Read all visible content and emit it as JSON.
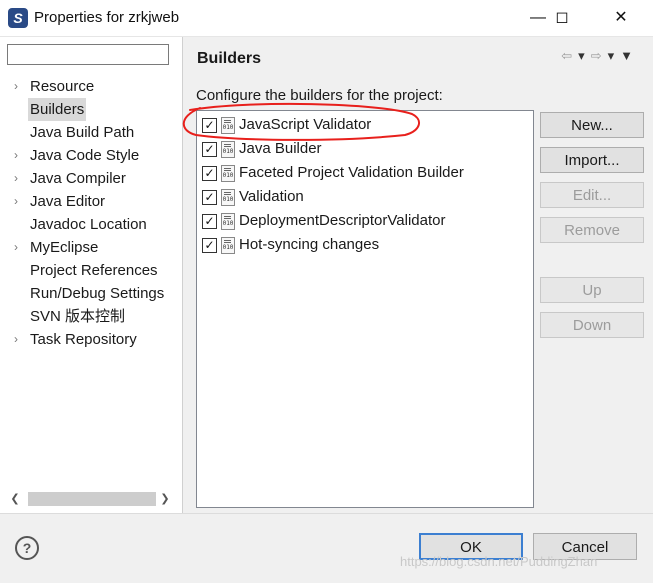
{
  "window": {
    "title": "Properties for zrkjweb",
    "app_icon": "myeclipse-icon"
  },
  "window_controls": [
    "minimize-icon",
    "maximize-icon",
    "close-icon"
  ],
  "left": {
    "filter_value": "",
    "items": [
      {
        "label": "Resource",
        "expandable": true
      },
      {
        "label": "Builders",
        "expandable": false,
        "selected": true
      },
      {
        "label": "Java Build Path",
        "expandable": false
      },
      {
        "label": "Java Code Style",
        "expandable": true
      },
      {
        "label": "Java Compiler",
        "expandable": true
      },
      {
        "label": "Java Editor",
        "expandable": true
      },
      {
        "label": "Javadoc Location",
        "expandable": false
      },
      {
        "label": "MyEclipse",
        "expandable": true
      },
      {
        "label": "Project References",
        "expandable": false
      },
      {
        "label": "Run/Debug Settings",
        "expandable": false
      },
      {
        "label": "SVN 版本控制",
        "expandable": false
      },
      {
        "label": "Task Repository",
        "expandable": true
      }
    ]
  },
  "main": {
    "title": "Builders",
    "description": "Configure the builders for the project:",
    "builders": [
      {
        "label": "JavaScript Validator",
        "checked": true
      },
      {
        "label": "Java Builder",
        "checked": true
      },
      {
        "label": "Faceted Project Validation Builder",
        "checked": true
      },
      {
        "label": "Validation",
        "checked": true
      },
      {
        "label": "DeploymentDescriptorValidator",
        "checked": true
      },
      {
        "label": "Hot-syncing changes",
        "checked": true
      }
    ],
    "buttons": {
      "new": "New...",
      "import": "Import...",
      "edit": "Edit...",
      "remove": "Remove",
      "up": "Up",
      "down": "Down"
    }
  },
  "footer": {
    "ok": "OK",
    "cancel": "Cancel",
    "watermark": "https://blog.csdn.net/PuddingZhan"
  },
  "colors": {
    "annotation_red": "#e8201c",
    "default_button_border": "#3c7fd1"
  }
}
